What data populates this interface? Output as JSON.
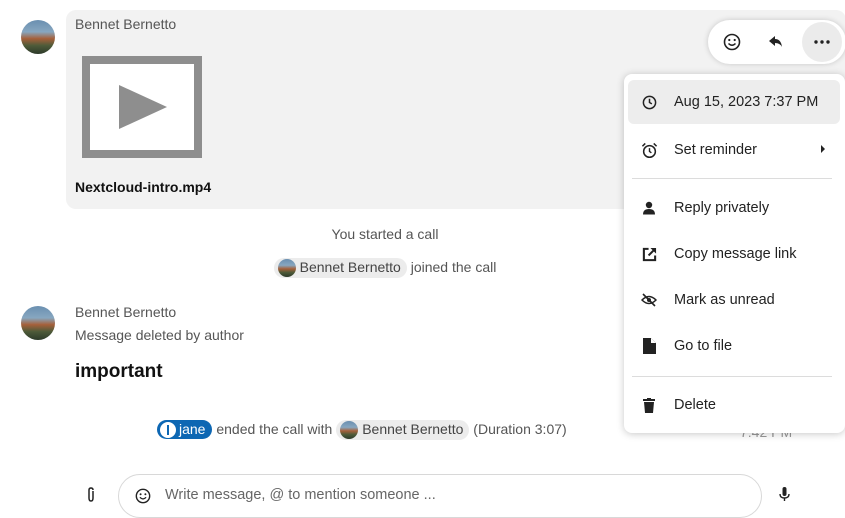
{
  "messages": [
    {
      "author": "Bennet Bernetto",
      "attachment": {
        "filename": "Nextcloud-intro.mp4",
        "kind": "video"
      }
    },
    {
      "author": "Bennet Bernetto",
      "deleted_text": "Message deleted by author",
      "body": "important",
      "timestamp_partial": "7:42 PM"
    }
  ],
  "system": {
    "started_call": "You started a call",
    "joined": {
      "user": "Bennet Bernetto",
      "text": "joined the call"
    },
    "ended": {
      "user": "jane",
      "text_mid": "ended the call with",
      "other_user": "Bennet Bernetto",
      "duration": "(Duration 3:07)"
    }
  },
  "toolbar": {
    "icons": [
      "emoji-icon",
      "reply-icon",
      "more-icon"
    ]
  },
  "menu": {
    "items": [
      {
        "label": "Aug 15, 2023 7:37 PM",
        "icon": "clock-icon"
      },
      {
        "label": "Set reminder",
        "icon": "alarm-icon",
        "submenu": true
      },
      {
        "label": "Reply privately",
        "icon": "person-icon"
      },
      {
        "label": "Copy message link",
        "icon": "external-link-icon"
      },
      {
        "label": "Mark as unread",
        "icon": "eye-off-icon"
      },
      {
        "label": "Go to file",
        "icon": "file-icon"
      },
      {
        "label": "Delete",
        "icon": "trash-icon"
      }
    ]
  },
  "composer": {
    "placeholder": "Write message, @ to mention someone ..."
  }
}
